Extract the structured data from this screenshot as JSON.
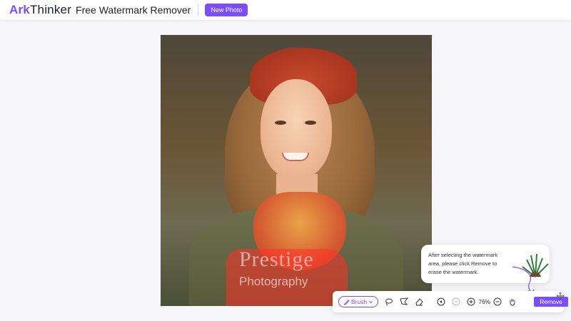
{
  "header": {
    "logo_prefix": "Ark",
    "logo_suffix": "Thinker",
    "app_title": "Free Watermark Remover",
    "new_photo_label": "New Photo"
  },
  "canvas": {
    "watermark_line1": "Prestige",
    "watermark_line2": "Photography"
  },
  "tooltip": {
    "text": "After selecting the watermark area, please click Remove to erase the watermark."
  },
  "toolbar": {
    "brush_label": "Brush",
    "zoom_level": "76%",
    "remove_label": "Remove"
  },
  "icons": {
    "brush": "brush-icon",
    "lasso": "lasso-icon",
    "polygon": "polygon-lasso-icon",
    "eraser": "eraser-icon",
    "undo": "undo-icon",
    "redo": "redo-icon",
    "zoom_in": "zoom-in-icon",
    "zoom_out": "zoom-out-icon",
    "hand": "hand-icon",
    "move": "move-icon"
  },
  "colors": {
    "accent": "#7c4dff",
    "background": "#f6f6fa"
  }
}
